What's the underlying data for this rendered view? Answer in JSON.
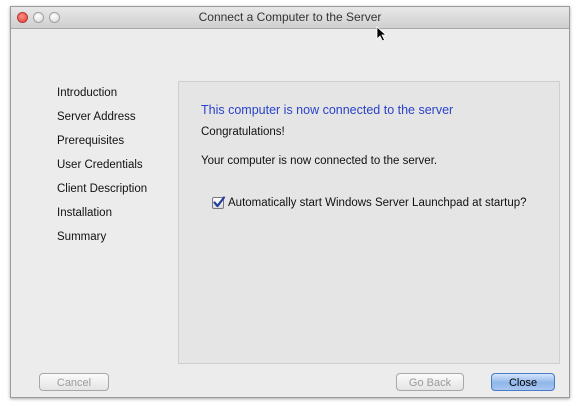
{
  "window": {
    "title": "Connect a Computer to the Server"
  },
  "sidebar": {
    "items": [
      {
        "label": "Introduction"
      },
      {
        "label": "Server Address"
      },
      {
        "label": "Prerequisites"
      },
      {
        "label": "User Credentials"
      },
      {
        "label": "Client Description"
      },
      {
        "label": "Installation"
      },
      {
        "label": "Summary"
      }
    ]
  },
  "main": {
    "heading": "This computer is now connected to the server",
    "congrats": "Congratulations!",
    "message": "Your computer is now connected to the server.",
    "checkbox_label": "Automatically start Windows Server Launchpad at startup?",
    "checkbox_checked": true,
    "heading_color": "#2a43c9"
  },
  "buttons": {
    "cancel": "Cancel",
    "back": "Go Back",
    "close": "Close"
  }
}
